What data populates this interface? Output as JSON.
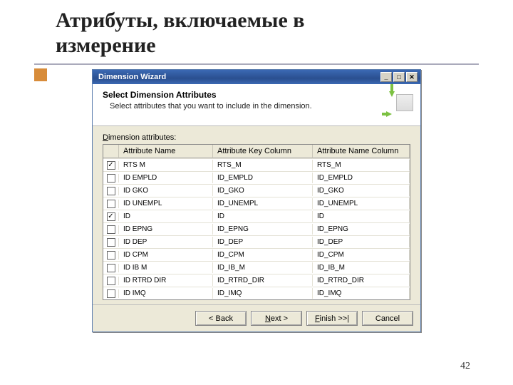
{
  "slide": {
    "title_line1": "Атрибуты, включаемые в",
    "title_line2": "измерение",
    "page_number": "42"
  },
  "window": {
    "title": "Dimension Wizard",
    "header_title": "Select Dimension Attributes",
    "header_subtitle": "Select attributes that you want to include in the dimension.",
    "grid_label_prefix": "D",
    "grid_label_rest": "imension attributes:"
  },
  "columns": {
    "attr_name": "Attribute Name",
    "attr_key": "Attribute Key Column",
    "attr_namecol": "Attribute Name Column"
  },
  "rows": [
    {
      "checked": true,
      "name": "RTS M",
      "key": "RTS_M",
      "namecol": "RTS_M"
    },
    {
      "checked": false,
      "name": "ID EMPLD",
      "key": "ID_EMPLD",
      "namecol": "ID_EMPLD"
    },
    {
      "checked": false,
      "name": "ID GKO",
      "key": "ID_GKO",
      "namecol": "ID_GKO"
    },
    {
      "checked": false,
      "name": "ID UNEMPL",
      "key": "ID_UNEMPL",
      "namecol": "ID_UNEMPL"
    },
    {
      "checked": true,
      "name": "ID",
      "key": "ID",
      "namecol": "ID"
    },
    {
      "checked": false,
      "name": "ID EPNG",
      "key": "ID_EPNG",
      "namecol": "ID_EPNG"
    },
    {
      "checked": false,
      "name": "ID DEP",
      "key": "ID_DEP",
      "namecol": "ID_DEP"
    },
    {
      "checked": false,
      "name": "ID CPM",
      "key": "ID_CPM",
      "namecol": "ID_CPM"
    },
    {
      "checked": false,
      "name": "ID IB M",
      "key": "ID_IB_M",
      "namecol": "ID_IB_M"
    },
    {
      "checked": false,
      "name": "ID RTRD DIR",
      "key": "ID_RTRD_DIR",
      "namecol": "ID_RTRD_DIR"
    },
    {
      "checked": false,
      "name": "ID IMQ",
      "key": "ID_IMQ",
      "namecol": "ID_IMQ"
    }
  ],
  "buttons": {
    "back": "< Back",
    "next_prefix": "N",
    "next_rest": "ext >",
    "finish_prefix": "F",
    "finish_rest": "inish >>|",
    "cancel": "Cancel"
  }
}
